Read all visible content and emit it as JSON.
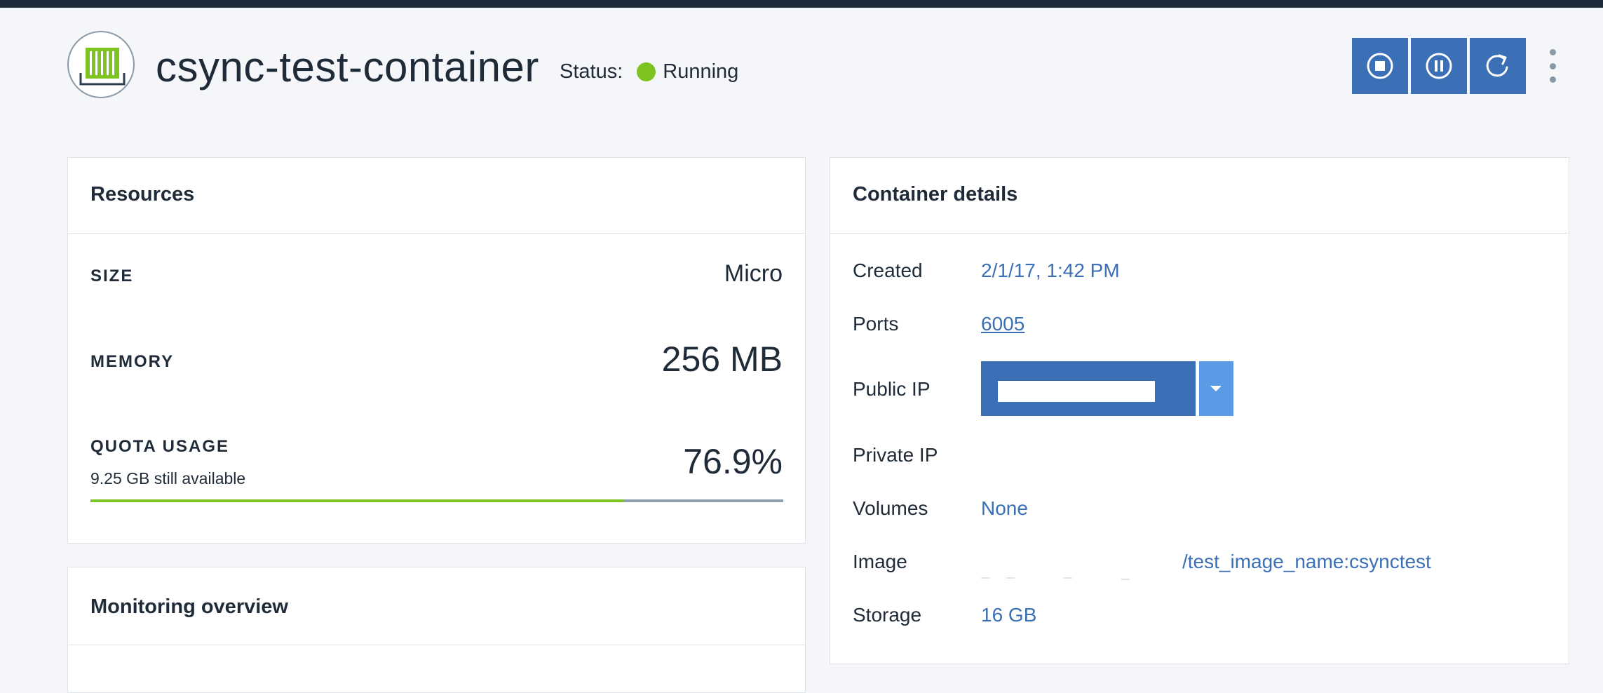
{
  "header": {
    "title": "csync-test-container",
    "status_label": "Status:",
    "status_value": "Running",
    "status_color": "#7dc420",
    "logo_icon": "container-icon",
    "actions": [
      {
        "name": "stop",
        "icon": "stop-icon"
      },
      {
        "name": "pause",
        "icon": "pause-icon"
      },
      {
        "name": "restart",
        "icon": "restart-icon"
      }
    ],
    "more_icon": "vertical-ellipsis-icon"
  },
  "resources": {
    "title": "Resources",
    "size_label": "SIZE",
    "size_value": "Micro",
    "memory_label": "MEMORY",
    "memory_value": "256 MB",
    "quota_label": "QUOTA USAGE",
    "quota_available": "9.25 GB still available",
    "quota_value": "76.9%",
    "quota_fraction": 0.769
  },
  "monitoring": {
    "title": "Monitoring overview"
  },
  "details": {
    "title": "Container details",
    "created_label": "Created",
    "created_value": "2/1/17, 1:42 PM",
    "ports_label": "Ports",
    "ports_value": "6005",
    "public_ip_label": "Public IP",
    "private_ip_label": "Private IP",
    "volumes_label": "Volumes",
    "volumes_value": "None",
    "image_label": "Image",
    "image_value": "/test_image_name:csynctest",
    "storage_label": "Storage",
    "storage_value": "16 GB"
  },
  "colors": {
    "accent": "#3b6fb6",
    "accent_light": "#5a9be6",
    "running": "#7dc420",
    "topbar": "#1c2a3a"
  }
}
